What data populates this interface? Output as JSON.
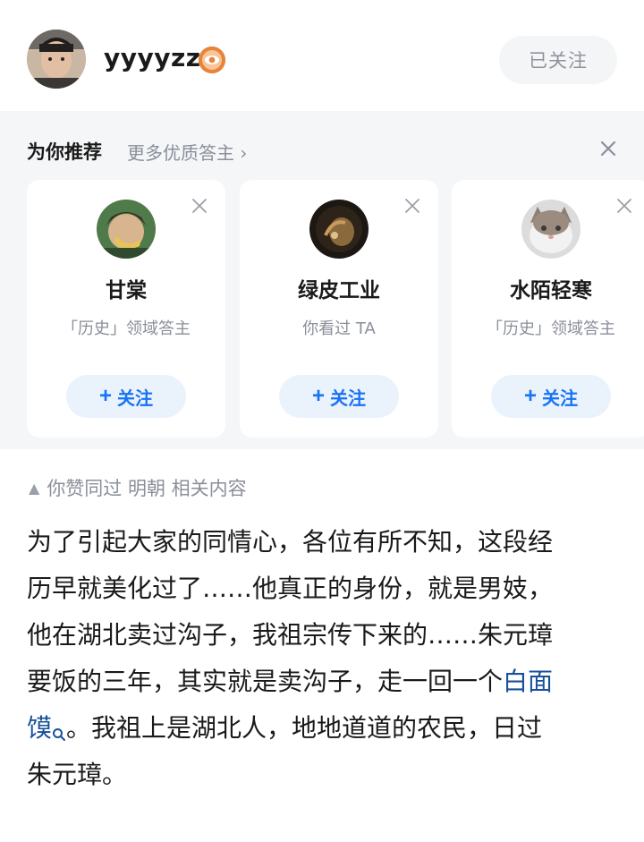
{
  "header": {
    "username": "yyyyzzz",
    "followed_label": "已关注"
  },
  "recommend": {
    "title": "为你推荐",
    "more": "更多优质答主 ›",
    "cards": [
      {
        "name": "甘棠",
        "desc": "「历史」领域答主",
        "follow": "关注"
      },
      {
        "name": "绿皮工业",
        "desc": "你看过 TA",
        "follow": "关注"
      },
      {
        "name": "水陌轻寒",
        "desc": "「历史」领域答主",
        "follow": "关注"
      }
    ]
  },
  "content": {
    "liked_line": "你赞同过 明朝 相关内容",
    "lines": [
      "为了引起大家的同情心，各位有所不知，这段经",
      "历早就美化过了……他真正的身份，就是男妓，",
      "他在湖北卖过沟子，我祖宗传下来的……朱元璋"
    ],
    "line4_before_link": "要饭的三年，其实就是卖沟子，走一回一个",
    "line4_link": "白面",
    "line5_link": "馍",
    "line5_after": "。我祖上是湖北人，地地道道的农民，日过",
    "line6": "朱元璋。"
  },
  "colors": {
    "accent": "#1772f6",
    "link": "#175199",
    "badge": "#e8833a"
  }
}
